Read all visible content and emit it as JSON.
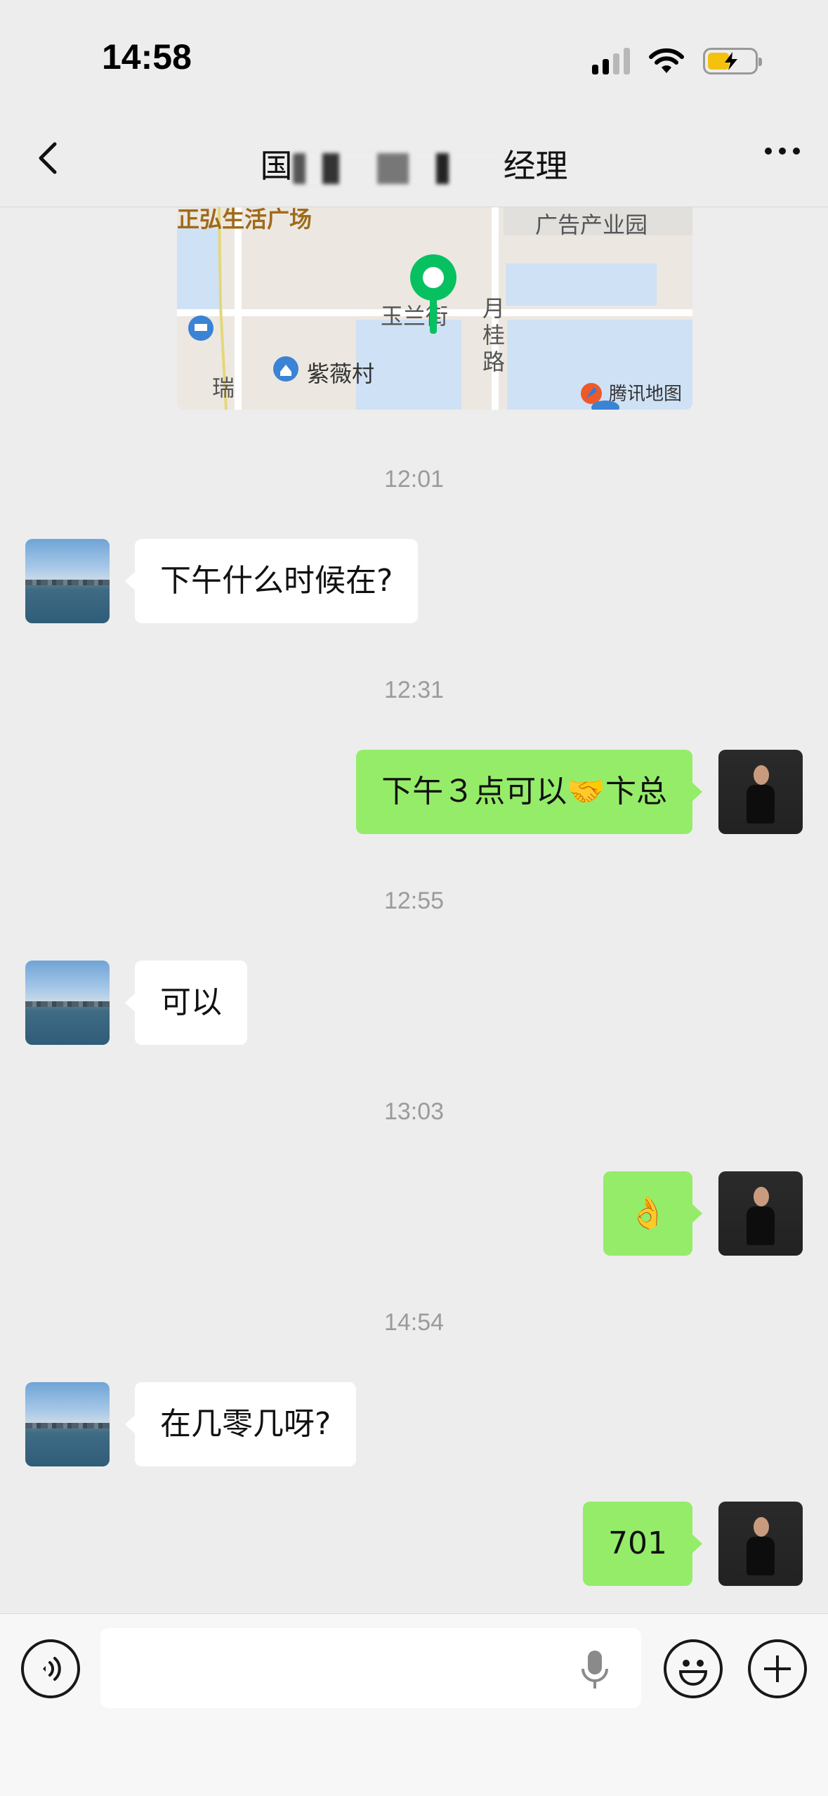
{
  "status_bar": {
    "time": "14:58"
  },
  "header": {
    "title_prefix": "国",
    "title_suffix": "经理"
  },
  "map": {
    "labels": {
      "plaza": "正弘生活广场",
      "ad_park": "广告产业园",
      "yulan": "玉兰街",
      "yuegui": "月桂路",
      "ziwei": "紫薇村",
      "rui": "瑞",
      "provider": "腾讯地图"
    }
  },
  "messages": [
    {
      "timestamp": "12:01",
      "side": "left",
      "text": "下午什么时候在?"
    },
    {
      "timestamp": "12:31",
      "side": "right",
      "text": "下午３点可以🤝卞总"
    },
    {
      "timestamp": "12:55",
      "side": "left",
      "text": "可以"
    },
    {
      "timestamp": "13:03",
      "side": "right",
      "text": "👌"
    },
    {
      "timestamp": "14:54",
      "side": "left",
      "text": "在几零几呀?"
    },
    {
      "timestamp": null,
      "side": "right",
      "text": "701"
    }
  ],
  "input": {
    "value": "",
    "placeholder": ""
  },
  "icons": {
    "back": "chevron-left-icon",
    "more": "more-icon",
    "voice": "voice-icon",
    "mic": "mic-icon",
    "emoji": "emoji-icon",
    "plus": "plus-icon"
  },
  "colors": {
    "background": "#ededed",
    "bubble_self": "#95ec69",
    "bubble_other": "#ffffff",
    "map_pin": "#07c160"
  }
}
